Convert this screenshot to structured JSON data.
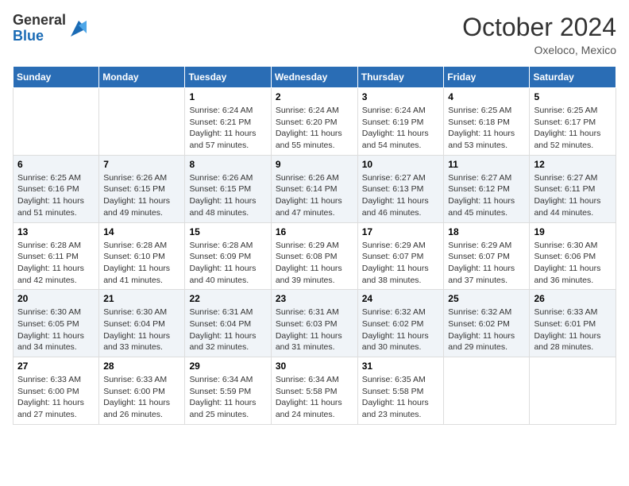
{
  "header": {
    "logo": {
      "line1": "General",
      "line2": "Blue"
    },
    "title": "October 2024",
    "location": "Oxeloco, Mexico"
  },
  "weekdays": [
    "Sunday",
    "Monday",
    "Tuesday",
    "Wednesday",
    "Thursday",
    "Friday",
    "Saturday"
  ],
  "weeks": [
    [
      {
        "day": "",
        "info": ""
      },
      {
        "day": "",
        "info": ""
      },
      {
        "day": "1",
        "info": "Sunrise: 6:24 AM\nSunset: 6:21 PM\nDaylight: 11 hours and 57 minutes."
      },
      {
        "day": "2",
        "info": "Sunrise: 6:24 AM\nSunset: 6:20 PM\nDaylight: 11 hours and 55 minutes."
      },
      {
        "day": "3",
        "info": "Sunrise: 6:24 AM\nSunset: 6:19 PM\nDaylight: 11 hours and 54 minutes."
      },
      {
        "day": "4",
        "info": "Sunrise: 6:25 AM\nSunset: 6:18 PM\nDaylight: 11 hours and 53 minutes."
      },
      {
        "day": "5",
        "info": "Sunrise: 6:25 AM\nSunset: 6:17 PM\nDaylight: 11 hours and 52 minutes."
      }
    ],
    [
      {
        "day": "6",
        "info": "Sunrise: 6:25 AM\nSunset: 6:16 PM\nDaylight: 11 hours and 51 minutes."
      },
      {
        "day": "7",
        "info": "Sunrise: 6:26 AM\nSunset: 6:15 PM\nDaylight: 11 hours and 49 minutes."
      },
      {
        "day": "8",
        "info": "Sunrise: 6:26 AM\nSunset: 6:15 PM\nDaylight: 11 hours and 48 minutes."
      },
      {
        "day": "9",
        "info": "Sunrise: 6:26 AM\nSunset: 6:14 PM\nDaylight: 11 hours and 47 minutes."
      },
      {
        "day": "10",
        "info": "Sunrise: 6:27 AM\nSunset: 6:13 PM\nDaylight: 11 hours and 46 minutes."
      },
      {
        "day": "11",
        "info": "Sunrise: 6:27 AM\nSunset: 6:12 PM\nDaylight: 11 hours and 45 minutes."
      },
      {
        "day": "12",
        "info": "Sunrise: 6:27 AM\nSunset: 6:11 PM\nDaylight: 11 hours and 44 minutes."
      }
    ],
    [
      {
        "day": "13",
        "info": "Sunrise: 6:28 AM\nSunset: 6:11 PM\nDaylight: 11 hours and 42 minutes."
      },
      {
        "day": "14",
        "info": "Sunrise: 6:28 AM\nSunset: 6:10 PM\nDaylight: 11 hours and 41 minutes."
      },
      {
        "day": "15",
        "info": "Sunrise: 6:28 AM\nSunset: 6:09 PM\nDaylight: 11 hours and 40 minutes."
      },
      {
        "day": "16",
        "info": "Sunrise: 6:29 AM\nSunset: 6:08 PM\nDaylight: 11 hours and 39 minutes."
      },
      {
        "day": "17",
        "info": "Sunrise: 6:29 AM\nSunset: 6:07 PM\nDaylight: 11 hours and 38 minutes."
      },
      {
        "day": "18",
        "info": "Sunrise: 6:29 AM\nSunset: 6:07 PM\nDaylight: 11 hours and 37 minutes."
      },
      {
        "day": "19",
        "info": "Sunrise: 6:30 AM\nSunset: 6:06 PM\nDaylight: 11 hours and 36 minutes."
      }
    ],
    [
      {
        "day": "20",
        "info": "Sunrise: 6:30 AM\nSunset: 6:05 PM\nDaylight: 11 hours and 34 minutes."
      },
      {
        "day": "21",
        "info": "Sunrise: 6:30 AM\nSunset: 6:04 PM\nDaylight: 11 hours and 33 minutes."
      },
      {
        "day": "22",
        "info": "Sunrise: 6:31 AM\nSunset: 6:04 PM\nDaylight: 11 hours and 32 minutes."
      },
      {
        "day": "23",
        "info": "Sunrise: 6:31 AM\nSunset: 6:03 PM\nDaylight: 11 hours and 31 minutes."
      },
      {
        "day": "24",
        "info": "Sunrise: 6:32 AM\nSunset: 6:02 PM\nDaylight: 11 hours and 30 minutes."
      },
      {
        "day": "25",
        "info": "Sunrise: 6:32 AM\nSunset: 6:02 PM\nDaylight: 11 hours and 29 minutes."
      },
      {
        "day": "26",
        "info": "Sunrise: 6:33 AM\nSunset: 6:01 PM\nDaylight: 11 hours and 28 minutes."
      }
    ],
    [
      {
        "day": "27",
        "info": "Sunrise: 6:33 AM\nSunset: 6:00 PM\nDaylight: 11 hours and 27 minutes."
      },
      {
        "day": "28",
        "info": "Sunrise: 6:33 AM\nSunset: 6:00 PM\nDaylight: 11 hours and 26 minutes."
      },
      {
        "day": "29",
        "info": "Sunrise: 6:34 AM\nSunset: 5:59 PM\nDaylight: 11 hours and 25 minutes."
      },
      {
        "day": "30",
        "info": "Sunrise: 6:34 AM\nSunset: 5:58 PM\nDaylight: 11 hours and 24 minutes."
      },
      {
        "day": "31",
        "info": "Sunrise: 6:35 AM\nSunset: 5:58 PM\nDaylight: 11 hours and 23 minutes."
      },
      {
        "day": "",
        "info": ""
      },
      {
        "day": "",
        "info": ""
      }
    ]
  ]
}
